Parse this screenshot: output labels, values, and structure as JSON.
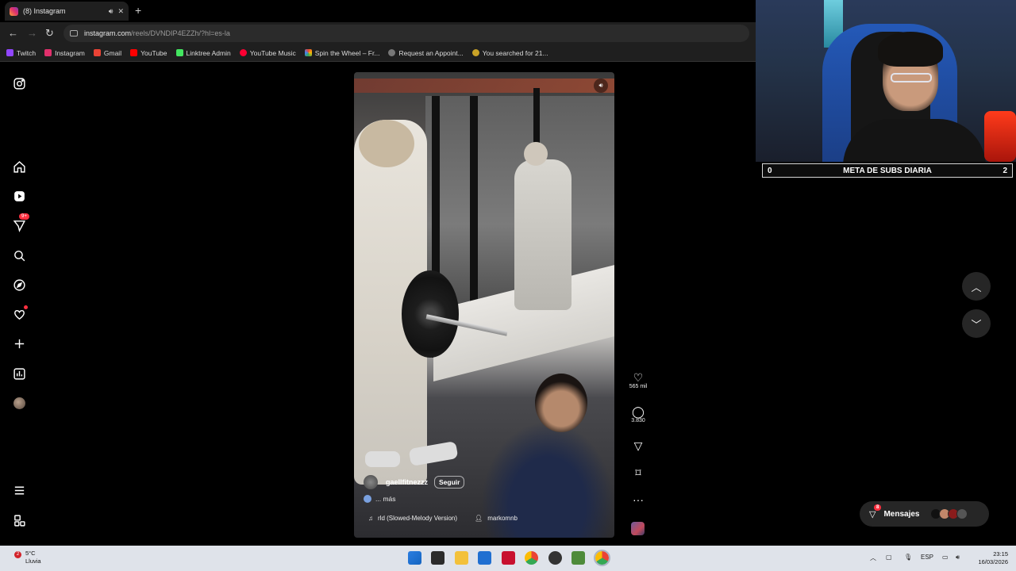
{
  "browser": {
    "tab_title": "(8) Instagram",
    "url_host": "instagram.com",
    "url_path": "/reels/DVNDIP4EZZh/?hl=es-la",
    "bookmarks": [
      {
        "label": "Twitch",
        "color": "#9146ff"
      },
      {
        "label": "Instagram",
        "color": "#e1306c"
      },
      {
        "label": "Gmail",
        "color": "#ea4335"
      },
      {
        "label": "YouTube",
        "color": "#ff0000"
      },
      {
        "label": "Linktree Admin",
        "color": "#43e660"
      },
      {
        "label": "YouTube Music",
        "color": "#ff0033"
      },
      {
        "label": "Spin the Wheel – Fr...",
        "color": "#f4b400"
      },
      {
        "label": "Request an Appoint...",
        "color": "#777777"
      },
      {
        "label": "You searched for 21...",
        "color": "#c9a227"
      }
    ]
  },
  "sidebar": {
    "notifications_badge": "9+"
  },
  "reel": {
    "username": "gaellfitnezzz",
    "follow_label": "Seguir",
    "caption": "... más",
    "audio_track": "rld (Slowed-Melody Version)",
    "audio_user": "markomnb",
    "likes": "565 mil",
    "comments": "3.830"
  },
  "messages": {
    "label": "Mensajes",
    "badge": "8"
  },
  "stream_overlay": {
    "goal_title": "META DE SUBS DIARIA",
    "goal_start": "0",
    "goal_target": "2"
  },
  "taskbar": {
    "weather_badge": "2",
    "temperature": "5°C",
    "condition": "Lluvia",
    "language": "ESP",
    "time": "23:15",
    "date": "16/03/2026"
  }
}
